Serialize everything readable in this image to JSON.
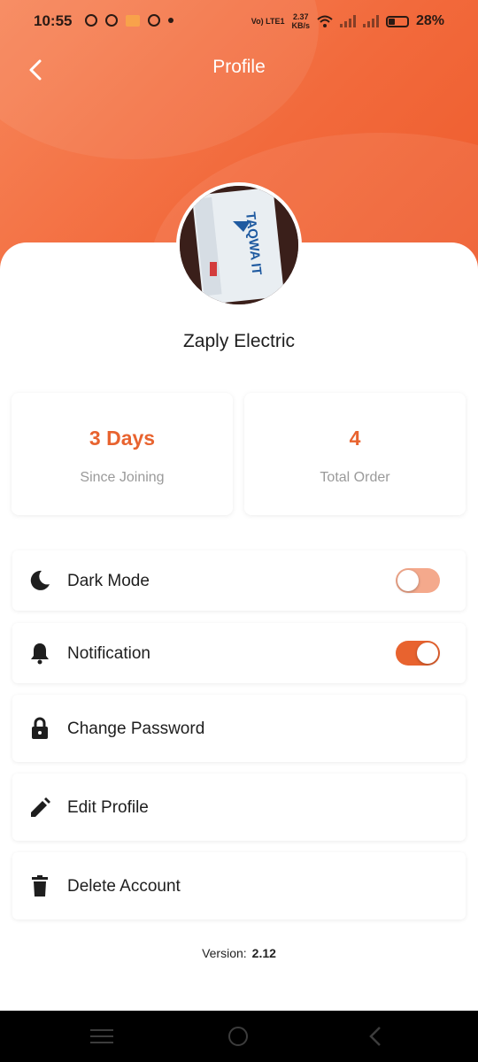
{
  "status_bar": {
    "time": "10:55",
    "volte": "Vo) LTE1",
    "net_speed_value": "2.37",
    "net_speed_unit": "KB/s",
    "battery": "28%"
  },
  "header": {
    "title": "Profile",
    "back_icon": "chevron-left-icon",
    "gradient_colors": [
      "#f7865a",
      "#ee5b2c"
    ]
  },
  "profile": {
    "name": "Zaply Electric",
    "avatar_logo_text": "TAQWA IT"
  },
  "stats": [
    {
      "value": "3 Days",
      "label": "Since Joining"
    },
    {
      "value": "4",
      "label": "Total Order"
    }
  ],
  "settings": [
    {
      "label": "Dark Mode",
      "icon": "moon-icon",
      "toggle": false
    },
    {
      "label": "Notification",
      "icon": "bell-icon",
      "toggle": true
    },
    {
      "label": "Change Password",
      "icon": "lock-icon"
    },
    {
      "label": "Edit Profile",
      "icon": "pencil-icon"
    },
    {
      "label": "Delete Account",
      "icon": "trash-icon"
    }
  ],
  "version": {
    "label": "Version:",
    "value": "2.12"
  },
  "colors": {
    "accent": "#e8632f",
    "toggle_off_track": "#f4a98c"
  }
}
